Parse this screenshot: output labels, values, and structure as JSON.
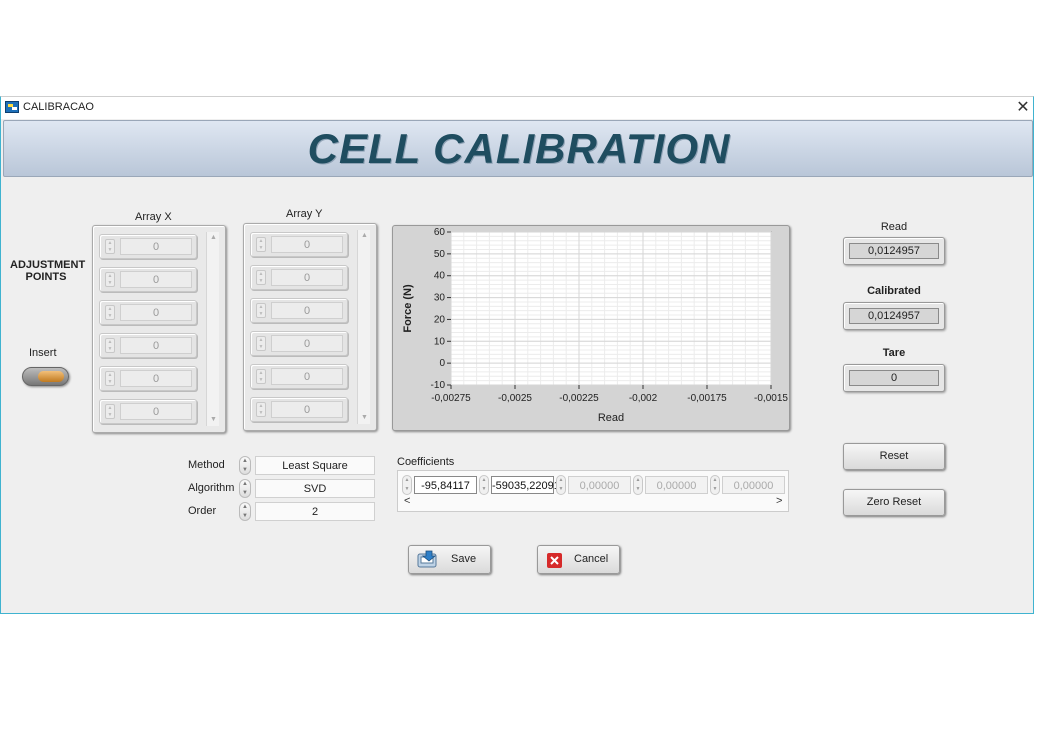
{
  "window": {
    "title": "CALIBRACAO",
    "close_symbol": "✕"
  },
  "banner": {
    "title": "CELL CALIBRATION"
  },
  "adjustment": {
    "label_line1": "ADJUSTMENT",
    "label_line2": "POINTS",
    "insert_label": "Insert"
  },
  "array_x": {
    "label": "Array X",
    "values": [
      "0",
      "0",
      "0",
      "0",
      "0",
      "0"
    ]
  },
  "array_y": {
    "label": "Array Y",
    "values": [
      "0",
      "0",
      "0",
      "0",
      "0",
      "0"
    ]
  },
  "settings": {
    "method_label": "Method",
    "method_value": "Least Square",
    "algorithm_label": "Algorithm",
    "algorithm_value": "SVD",
    "order_label": "Order",
    "order_value": "2"
  },
  "coefficients": {
    "label": "Coefficients",
    "values": [
      "-95,84117",
      "-59035,22091",
      "0,00000",
      "0,00000",
      "0,00000"
    ],
    "scroll_left": "<",
    "scroll_right": ">"
  },
  "chart_data": {
    "type": "line",
    "xlabel": "Read",
    "ylabel": "Force (N)",
    "xlim": [
      -0.00275,
      -0.0015
    ],
    "ylim": [
      -10,
      60
    ],
    "x_ticks": [
      "-0,00275",
      "-0,0025",
      "-0,00225",
      "-0,002",
      "-0,00175",
      "-0,0015"
    ],
    "y_ticks": [
      "60",
      "50",
      "40",
      "30",
      "20",
      "10",
      "0",
      "-10"
    ],
    "grid": true,
    "series": []
  },
  "indicators": {
    "read_label": "Read",
    "read_value": "0,0124957",
    "calibrated_label": "Calibrated",
    "calibrated_value": "0,0124957",
    "tare_label": "Tare",
    "tare_value": "0"
  },
  "buttons": {
    "reset": "Reset",
    "zero_reset": "Zero Reset",
    "save": "Save",
    "cancel": "Cancel"
  }
}
